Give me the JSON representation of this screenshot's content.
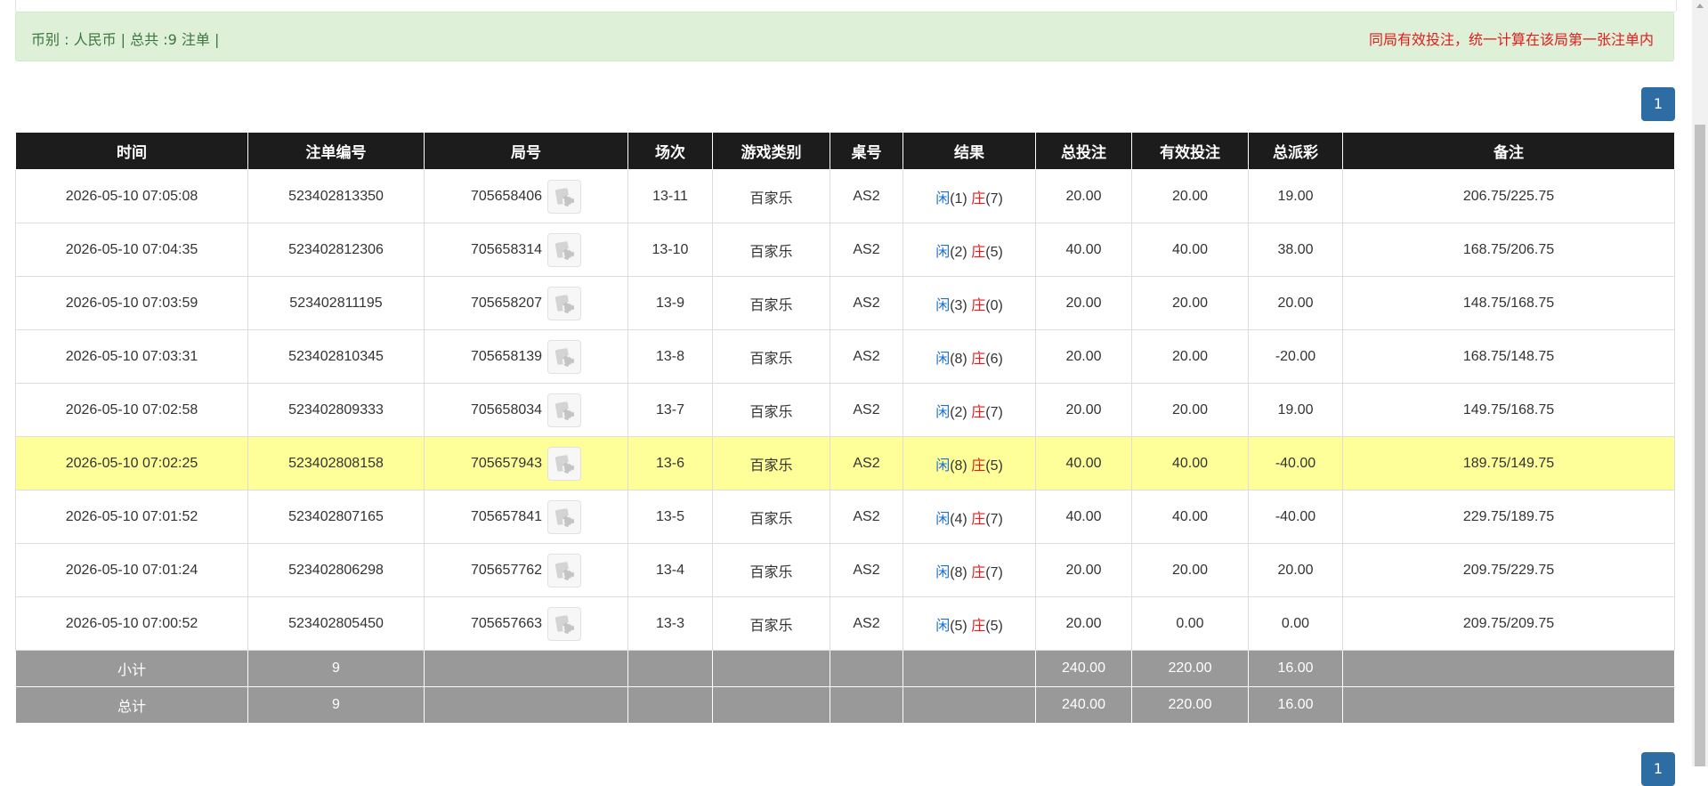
{
  "info": {
    "left": "币别 : 人民币 | 总共 :9 注单 |",
    "right": "同局有效投注，统一计算在该局第一张注单内"
  },
  "pagination": {
    "page": "1"
  },
  "table": {
    "headers": [
      "时间",
      "注单编号",
      "局号",
      "场次",
      "游戏类别",
      "桌号",
      "结果",
      "总投注",
      "有效投注",
      "总派彩",
      "备注"
    ],
    "rows": [
      {
        "time": "2026-05-10 07:05:08",
        "bet_id": "523402813350",
        "round": "705658406",
        "session": "13-11",
        "game": "百家乐",
        "table": "AS2",
        "player_label": "闲",
        "player_score": "(1)",
        "banker_label": "庄",
        "banker_score": "(7)",
        "total_bet": "20.00",
        "valid_bet": "20.00",
        "payout": "19.00",
        "payout_negative": false,
        "note": "206.75/225.75",
        "highlight": false
      },
      {
        "time": "2026-05-10 07:04:35",
        "bet_id": "523402812306",
        "round": "705658314",
        "session": "13-10",
        "game": "百家乐",
        "table": "AS2",
        "player_label": "闲",
        "player_score": "(2)",
        "banker_label": "庄",
        "banker_score": "(5)",
        "total_bet": "40.00",
        "valid_bet": "40.00",
        "payout": "38.00",
        "payout_negative": false,
        "note": "168.75/206.75",
        "highlight": false
      },
      {
        "time": "2026-05-10 07:03:59",
        "bet_id": "523402811195",
        "round": "705658207",
        "session": "13-9",
        "game": "百家乐",
        "table": "AS2",
        "player_label": "闲",
        "player_score": "(3)",
        "banker_label": "庄",
        "banker_score": "(0)",
        "total_bet": "20.00",
        "valid_bet": "20.00",
        "payout": "20.00",
        "payout_negative": false,
        "note": "148.75/168.75",
        "highlight": false
      },
      {
        "time": "2026-05-10 07:03:31",
        "bet_id": "523402810345",
        "round": "705658139",
        "session": "13-8",
        "game": "百家乐",
        "table": "AS2",
        "player_label": "闲",
        "player_score": "(8)",
        "banker_label": "庄",
        "banker_score": "(6)",
        "total_bet": "20.00",
        "valid_bet": "20.00",
        "payout": "-20.00",
        "payout_negative": true,
        "note": "168.75/148.75",
        "highlight": false
      },
      {
        "time": "2026-05-10 07:02:58",
        "bet_id": "523402809333",
        "round": "705658034",
        "session": "13-7",
        "game": "百家乐",
        "table": "AS2",
        "player_label": "闲",
        "player_score": "(2)",
        "banker_label": "庄",
        "banker_score": "(7)",
        "total_bet": "20.00",
        "valid_bet": "20.00",
        "payout": "19.00",
        "payout_negative": false,
        "note": "149.75/168.75",
        "highlight": false
      },
      {
        "time": "2026-05-10 07:02:25",
        "bet_id": "523402808158",
        "round": "705657943",
        "session": "13-6",
        "game": "百家乐",
        "table": "AS2",
        "player_label": "闲",
        "player_score": "(8)",
        "banker_label": "庄",
        "banker_score": "(5)",
        "total_bet": "40.00",
        "valid_bet": "40.00",
        "payout": "-40.00",
        "payout_negative": true,
        "note": "189.75/149.75",
        "highlight": true
      },
      {
        "time": "2026-05-10 07:01:52",
        "bet_id": "523402807165",
        "round": "705657841",
        "session": "13-5",
        "game": "百家乐",
        "table": "AS2",
        "player_label": "闲",
        "player_score": "(4)",
        "banker_label": "庄",
        "banker_score": "(7)",
        "total_bet": "40.00",
        "valid_bet": "40.00",
        "payout": "-40.00",
        "payout_negative": true,
        "note": "229.75/189.75",
        "highlight": false
      },
      {
        "time": "2026-05-10 07:01:24",
        "bet_id": "523402806298",
        "round": "705657762",
        "session": "13-4",
        "game": "百家乐",
        "table": "AS2",
        "player_label": "闲",
        "player_score": "(8)",
        "banker_label": "庄",
        "banker_score": "(7)",
        "total_bet": "20.00",
        "valid_bet": "20.00",
        "payout": "20.00",
        "payout_negative": false,
        "note": "209.75/229.75",
        "highlight": false
      },
      {
        "time": "2026-05-10 07:00:52",
        "bet_id": "523402805450",
        "round": "705657663",
        "session": "13-3",
        "game": "百家乐",
        "table": "AS2",
        "player_label": "闲",
        "player_score": "(5)",
        "banker_label": "庄",
        "banker_score": "(5)",
        "total_bet": "20.00",
        "valid_bet": "0.00",
        "payout": "0.00",
        "payout_negative": false,
        "note": "209.75/209.75",
        "highlight": false
      }
    ],
    "subtotal": {
      "label": "小计",
      "count": "9",
      "total_bet": "240.00",
      "valid_bet": "220.00",
      "payout": "16.00"
    },
    "grandtotal": {
      "label": "总计",
      "count": "9",
      "total_bet": "240.00",
      "valid_bet": "220.00",
      "payout": "16.00"
    }
  },
  "colors": {
    "header_bg": "#1c1c1c",
    "info_bg": "#dff0d8",
    "highlight_row": "#ffff99",
    "sum_row_bg": "#999999",
    "player_blue": "#1a6fd6",
    "banker_red": "#e41b1b",
    "page_button": "#2e6da4"
  },
  "icons": {
    "round_detail": "baccarat-cards-chip-icon"
  }
}
